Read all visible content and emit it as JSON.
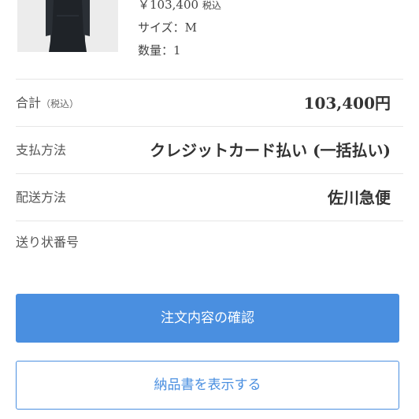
{
  "product": {
    "price": "￥103,400",
    "price_tax": "税込",
    "size_label": "サイズ：",
    "size_value": "M",
    "quantity_label": "数量：",
    "quantity_value": "1"
  },
  "summary": {
    "total_label": "合計",
    "total_tax_note": "（税込）",
    "total_value": "103,400円",
    "payment_label": "支払方法",
    "payment_value": "クレジットカード払い (一括払い)",
    "shipping_label": "配送方法",
    "shipping_value": "佐川急便",
    "tracking_label": "送り状番号",
    "tracking_value": ""
  },
  "actions": {
    "confirm_label": "注文内容の確認",
    "invoice_label": "納品書を表示する"
  },
  "colors": {
    "accent": "#4a8fe0",
    "divider": "#e6e6e6"
  }
}
